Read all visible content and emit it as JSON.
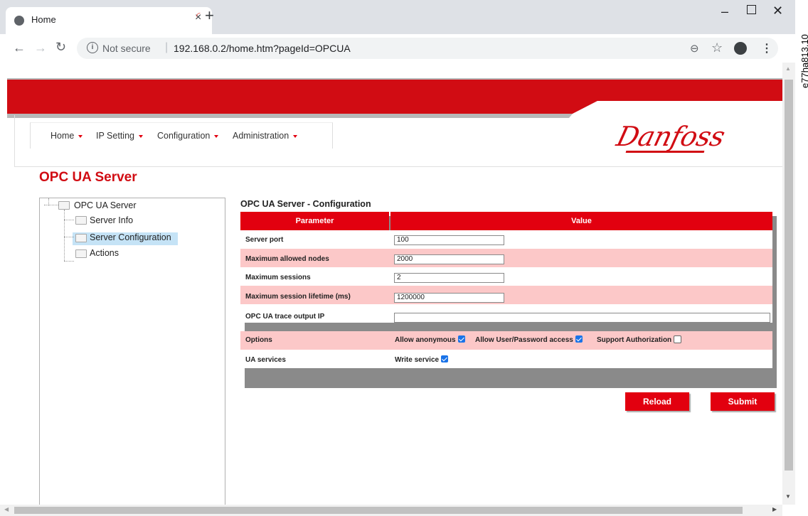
{
  "browser": {
    "tab_title": "Home",
    "tab_close": "×",
    "new_tab": "+",
    "url_security": "Not secure",
    "url_separator": "|",
    "url": "192.168.0.2/home.htm?pageId=OPCUA",
    "win_min": "–",
    "win_close": "✕"
  },
  "watermark": "e77ha813.10",
  "nav": {
    "home": "Home",
    "ip_setting": "IP Setting",
    "configuration": "Configuration",
    "administration": "Administration"
  },
  "brand": "Danfoss",
  "page_title": "OPC UA Server",
  "tree": {
    "root": "OPC UA Server",
    "items": [
      "Server Info",
      "Server Configuration",
      "Actions"
    ],
    "selected": "Server Configuration"
  },
  "config": {
    "title": "OPC UA Server - Configuration",
    "col_parameter": "Parameter",
    "col_value": "Value",
    "rows": [
      {
        "label": "Server port",
        "value": "100"
      },
      {
        "label": "Maximum allowed nodes",
        "value": "2000"
      },
      {
        "label": "Maximum sessions",
        "value": "2"
      },
      {
        "label": "Maximum session lifetime (ms)",
        "value": "1200000"
      },
      {
        "label": "OPC UA trace output IP",
        "value": ""
      },
      {
        "label": "Options",
        "value": ""
      },
      {
        "label": "UA services",
        "value": ""
      }
    ],
    "options": {
      "allow_anonymous": {
        "label": "Allow anonymous",
        "checked": true
      },
      "allow_user_password": {
        "label": "Allow User/Password access",
        "checked": true
      },
      "support_authorization": {
        "label": "Support Authorization",
        "checked": false
      }
    },
    "ua_services": {
      "write_service": {
        "label": "Write service",
        "checked": true
      }
    }
  },
  "buttons": {
    "reload": "Reload",
    "submit": "Submit"
  },
  "colors": {
    "brand_red": "#d10c13",
    "header_red": "#e2000f",
    "row_pink": "#fcc8c8",
    "selected_blue": "#c5e3f6"
  }
}
